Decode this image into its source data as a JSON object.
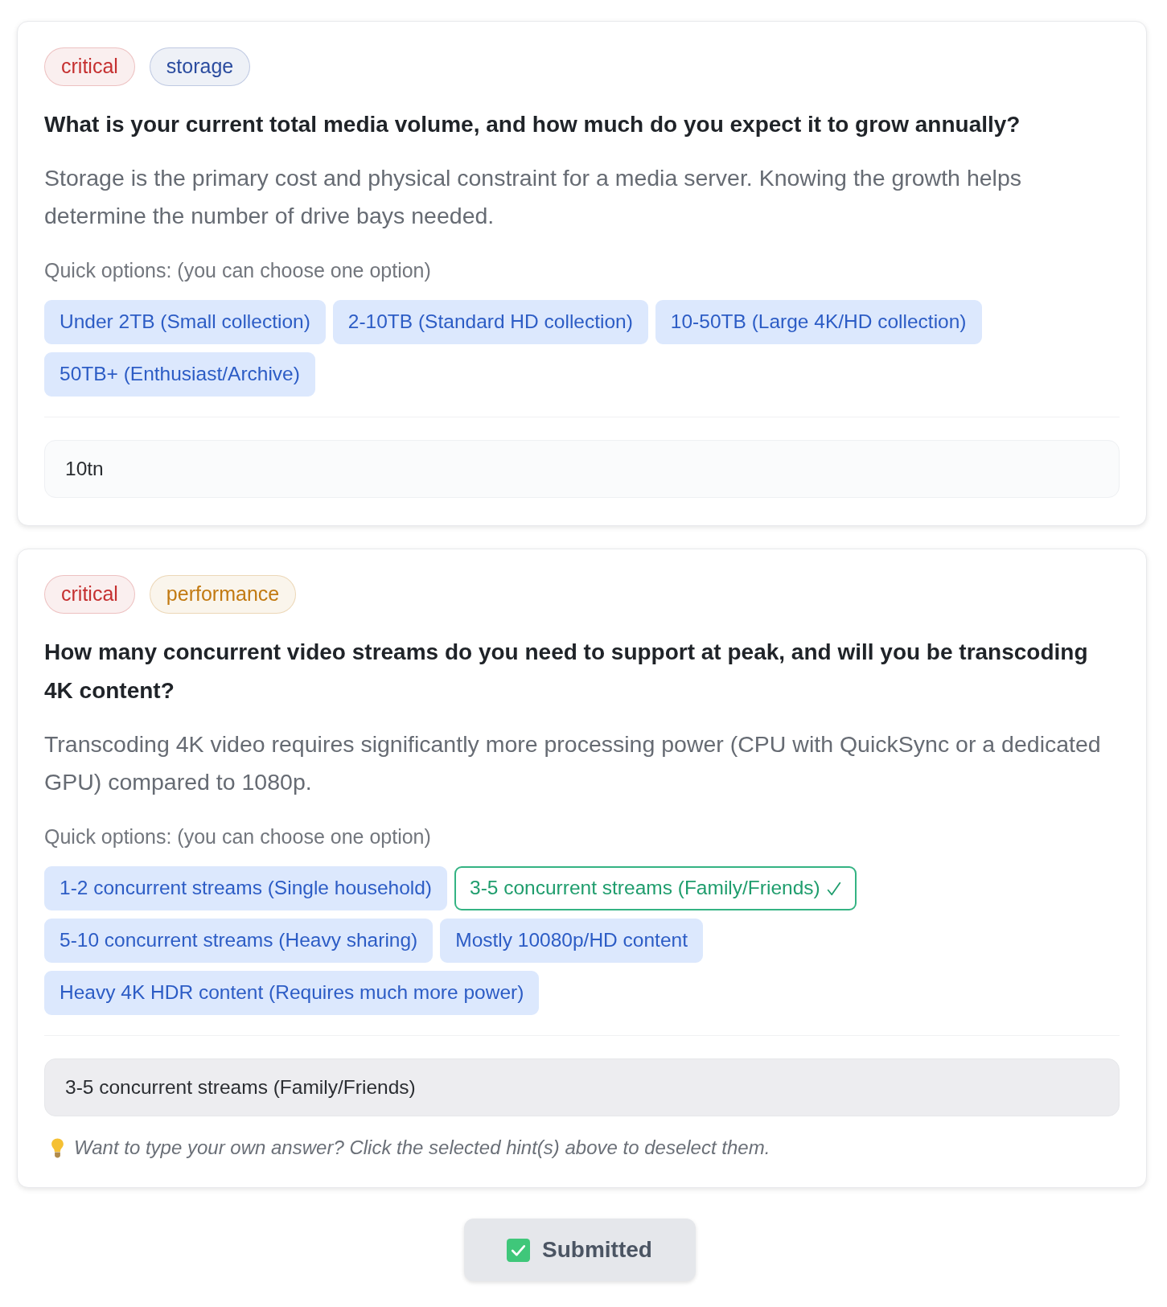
{
  "questions": [
    {
      "tags": [
        {
          "label": "critical",
          "color": "#c53030"
        },
        {
          "label": "storage",
          "color": "#2b4c9f"
        }
      ],
      "question": "What is your current total media volume, and how much do you expect it to grow annually?",
      "description": "Storage is the primary cost and physical constraint for a media server. Knowing the growth helps determine the number of drive bays needed.",
      "options_label": "Quick options: (you can choose one option)",
      "options": [
        {
          "label": "Under 2TB (Small collection)",
          "selected": false
        },
        {
          "label": "2-10TB (Standard HD collection)",
          "selected": false
        },
        {
          "label": "10-50TB (Large 4K/HD collection)",
          "selected": false
        },
        {
          "label": "50TB+ (Enthusiast/Archive)",
          "selected": false
        }
      ],
      "answer": {
        "value": "10tn",
        "disabled": false
      }
    },
    {
      "tags": [
        {
          "label": "critical",
          "color": "#c53030"
        },
        {
          "label": "performance",
          "color": "#c27a12"
        }
      ],
      "question": "How many concurrent video streams do you need to support at peak, and will you be transcoding 4K content?",
      "description": "Transcoding 4K video requires significantly more processing power (CPU with QuickSync or a dedicated GPU) compared to 1080p.",
      "options_label": "Quick options: (you can choose one option)",
      "options": [
        {
          "label": "1-2 concurrent streams (Single household)",
          "selected": false
        },
        {
          "label": "3-5 concurrent streams (Family/Friends)",
          "selected": true
        },
        {
          "label": "5-10 concurrent streams (Heavy sharing)",
          "selected": false
        },
        {
          "label": "Mostly 10080p/HD content",
          "selected": false
        },
        {
          "label": "Heavy 4K HDR content (Requires much more power)",
          "selected": false
        }
      ],
      "answer": {
        "value": "3-5 concurrent streams (Family/Friends)",
        "disabled": true
      },
      "note": "Want to type your own answer? Click the selected hint(s) above to deselect them."
    }
  ],
  "submit": {
    "label": "Submitted",
    "disabled": true
  }
}
